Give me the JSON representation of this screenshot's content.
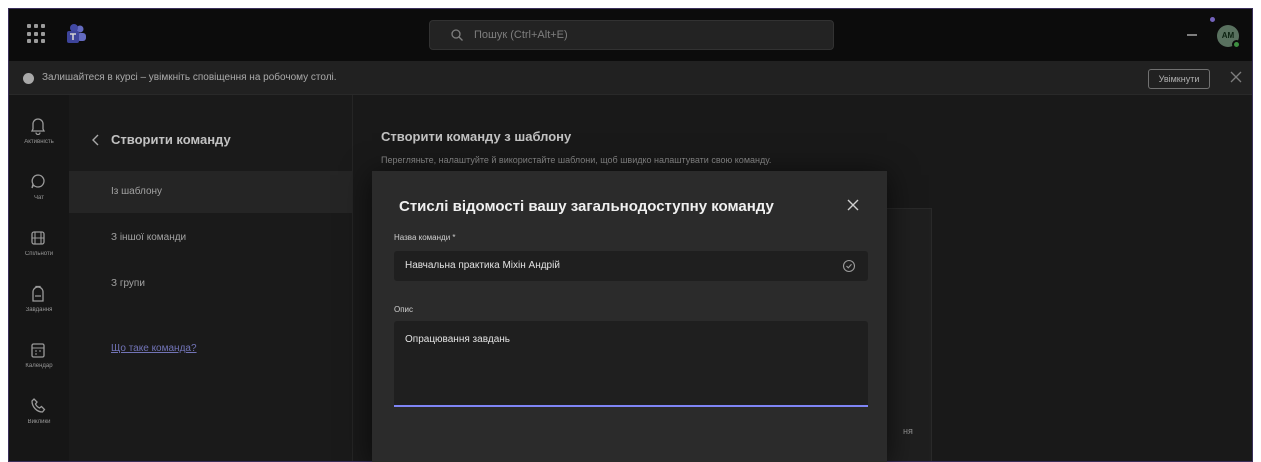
{
  "titlebar": {
    "search_placeholder": "Пошук (Ctrl+Alt+E)",
    "avatar_initials": "AM"
  },
  "notification": {
    "text": "Залишайтеся в курсі – увімкніть сповіщення на робочому столі.",
    "enable_label": "Увімкнути"
  },
  "rail": {
    "items": [
      {
        "label": "Активність",
        "icon": "bell-icon"
      },
      {
        "label": "Чат",
        "icon": "chat-icon"
      },
      {
        "label": "Спільноти",
        "icon": "people-icon"
      },
      {
        "label": "Завдання",
        "icon": "backpack-icon"
      },
      {
        "label": "Календар",
        "icon": "calendar-icon"
      },
      {
        "label": "Виклики",
        "icon": "phone-icon"
      }
    ]
  },
  "left_panel": {
    "title": "Створити команду",
    "items": [
      {
        "label": "Із шаблону",
        "active": true
      },
      {
        "label": "З іншої команди",
        "active": false
      },
      {
        "label": "З групи",
        "active": false
      }
    ],
    "link": "Що таке команда?"
  },
  "main": {
    "title": "Створити команду з шаблону",
    "subtitle": "Перегляньте, налаштуйте й використайте шаблони, щоб швидко налаштувати свою команду.",
    "card_text": "ня"
  },
  "modal": {
    "title": "Стислі відомості вашу загальнодоступну команду",
    "name_label": "Назва команди *",
    "name_value": "Навчальна практика Міхін Андрій",
    "desc_label": "Опис",
    "desc_value": "Опрацювання завдань"
  },
  "colors": {
    "accent": "#7f85f5",
    "link": "#8b8ee0",
    "background": "#1f1f1f",
    "modal": "#2b2b2b"
  }
}
